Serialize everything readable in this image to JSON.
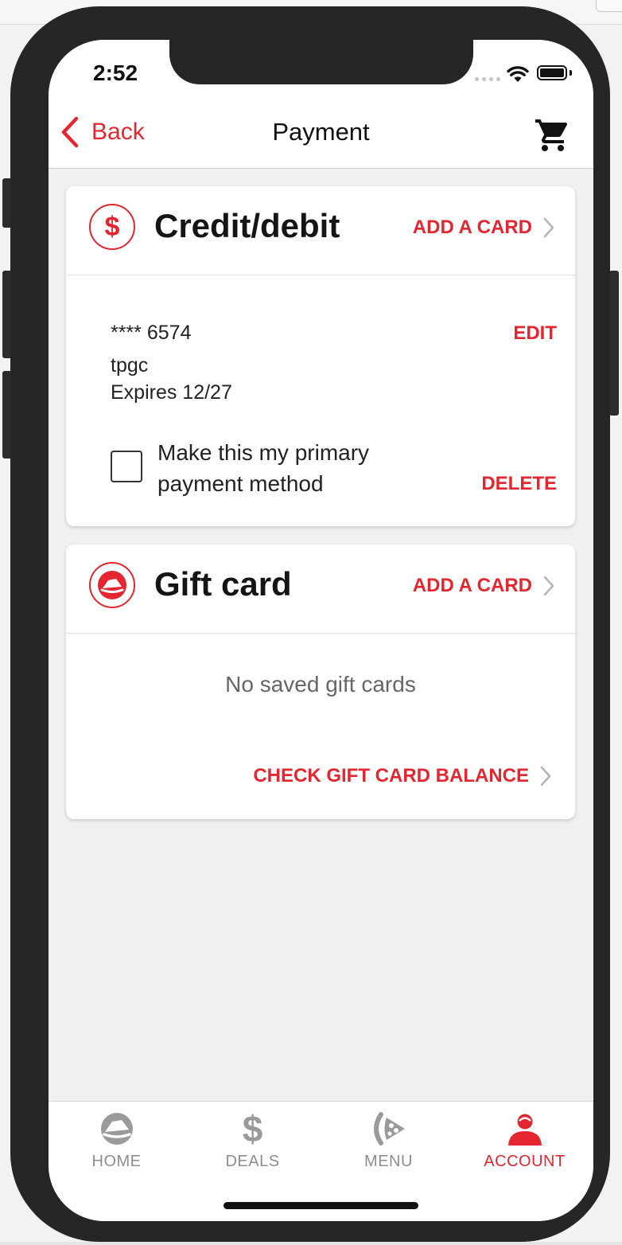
{
  "status_bar": {
    "time": "2:52"
  },
  "header": {
    "back_label": "Back",
    "title": "Payment",
    "cart_icon": "cart-icon"
  },
  "credit_section": {
    "title": "Credit/debit",
    "icon": "dollar-icon",
    "add_label": "ADD A CARD",
    "card": {
      "masked_number": "**** 6574",
      "holder": "tpgc",
      "expires": "Expires 12/27",
      "edit_label": "EDIT",
      "delete_label": "DELETE",
      "primary_checkbox_label": "Make this my primary payment method",
      "primary_checked": false
    }
  },
  "gift_section": {
    "title": "Gift card",
    "icon": "pizza-hut-logo-icon",
    "add_label": "ADD A CARD",
    "empty_message": "No saved gift cards",
    "check_balance_label": "CHECK GIFT CARD BALANCE"
  },
  "tabs": [
    {
      "label": "HOME",
      "icon": "home-icon",
      "active": false
    },
    {
      "label": "DEALS",
      "icon": "deals-icon",
      "active": false
    },
    {
      "label": "MENU",
      "icon": "menu-icon",
      "active": false
    },
    {
      "label": "ACCOUNT",
      "icon": "account-icon",
      "active": true
    }
  ],
  "colors": {
    "accent": "#e3262f",
    "inactive": "#8e8e8e",
    "text": "#151515",
    "background": "#f0f0f0"
  }
}
